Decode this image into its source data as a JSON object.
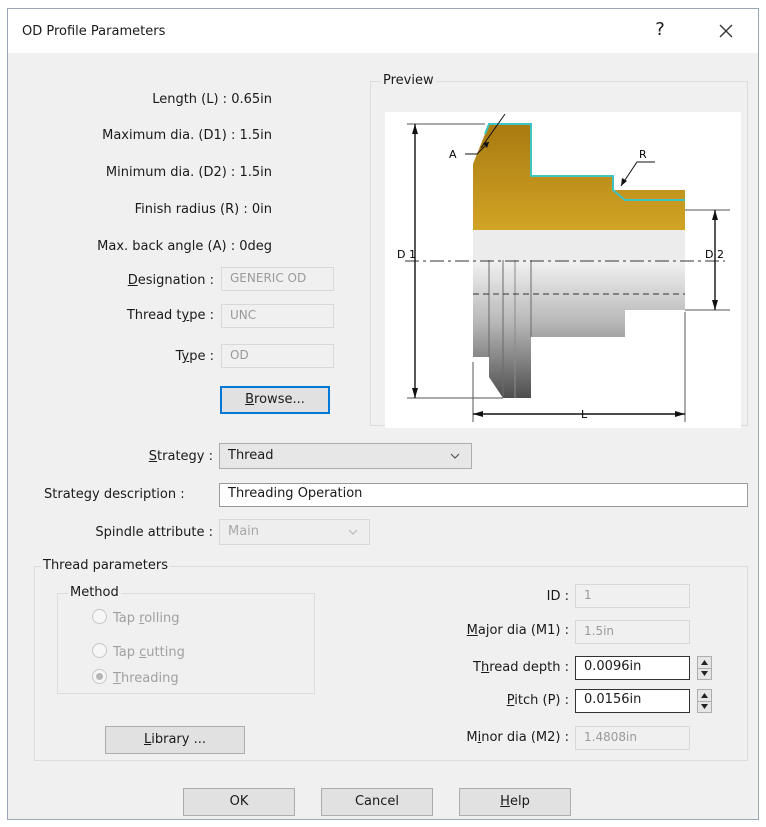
{
  "window": {
    "title": "OD Profile Parameters",
    "help_symbol": "?",
    "close_icon": "close-icon"
  },
  "properties": [
    {
      "label": "Length (L) :",
      "value": "0.65in"
    },
    {
      "label": "Maximum dia. (D1) :",
      "value": "1.5in"
    },
    {
      "label": "Minimum dia. (D2) :",
      "value": "1.5in"
    },
    {
      "label": "Finish radius (R) :",
      "value": "0in"
    },
    {
      "label": "Max. back angle (A) :",
      "value": "0deg"
    }
  ],
  "designation": {
    "label_pre": "",
    "label_u": "D",
    "label_post": "esignation :",
    "value": "GENERIC OD"
  },
  "thread_type": {
    "label_pre": "Thread t",
    "label_u": "y",
    "label_post": "pe :",
    "value": "UNC"
  },
  "type": {
    "label_pre": "T",
    "label_u": "y",
    "label_post": "pe :",
    "value": "OD"
  },
  "browse_button": {
    "pre": "",
    "u": "B",
    "post": "rowse..."
  },
  "preview": {
    "caption": "Preview",
    "labels": {
      "a": "A",
      "r": "R",
      "d1": "D 1",
      "d2": "D 2",
      "l": "L"
    },
    "colors": {
      "body": "#c49416",
      "edge": "#3fc4c4",
      "steel_light": "#e8e8e8",
      "steel_dark": "#5a5a5a"
    }
  },
  "strategy": {
    "label_pre": "",
    "label_u": "S",
    "label_post": "trategy :",
    "value": "Thread"
  },
  "strategy_description": {
    "label": "Strategy description :",
    "value": "Threading Operation"
  },
  "spindle_attribute": {
    "label": "Spindle attribute :",
    "value": "Main"
  },
  "thread_parameters": {
    "caption": "Thread parameters",
    "method": {
      "caption": "Method",
      "options": [
        {
          "pre": "Tap ",
          "u": "r",
          "post": "olling",
          "checked": false
        },
        {
          "pre": "Tap ",
          "u": "c",
          "post": "utting",
          "checked": false
        },
        {
          "pre": "",
          "u": "T",
          "post": "hreading",
          "checked": true
        }
      ]
    },
    "library_button": {
      "pre": "",
      "u": "L",
      "post": "ibrary ..."
    },
    "id": {
      "label": "ID :",
      "value": "1"
    },
    "major_dia": {
      "label_pre": "",
      "label_u": "M",
      "label_post": "ajor dia (M1) :",
      "value": "1.5in"
    },
    "thread_depth": {
      "label_pre": "T",
      "label_u": "h",
      "label_post": "read depth :",
      "value": "0.0096in"
    },
    "pitch": {
      "label_pre": "",
      "label_u": "P",
      "label_post": "itch (P) :",
      "value": "0.0156in"
    },
    "minor_dia": {
      "label_pre": "M",
      "label_u": "i",
      "label_post": "nor dia (M2) :",
      "value": "1.4808in"
    }
  },
  "footer": {
    "ok": "OK",
    "cancel": "Cancel",
    "help": {
      "pre": "",
      "u": "H",
      "post": "elp"
    }
  }
}
